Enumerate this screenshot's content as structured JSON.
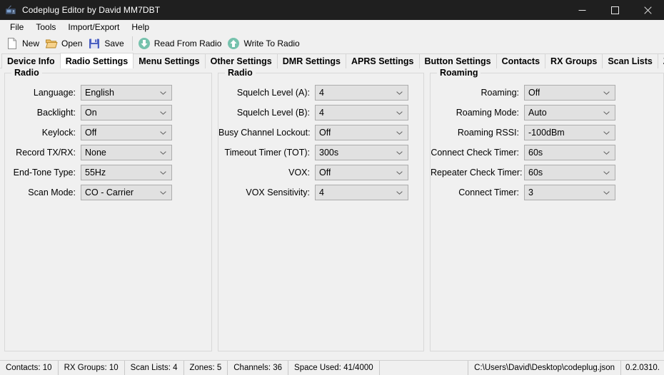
{
  "window": {
    "title": "Codeplug Editor by David MM7DBT",
    "icon": "radio-app-icon",
    "controls": {
      "minimize": "minimize-icon",
      "maximize": "maximize-icon",
      "close": "close-icon"
    },
    "titlebar_bg": "#1f1f1f",
    "titlebar_fg": "#ffffff"
  },
  "menubar": {
    "items": [
      {
        "label": "File"
      },
      {
        "label": "Tools"
      },
      {
        "label": "Import/Export"
      },
      {
        "label": "Help"
      }
    ]
  },
  "toolbar": {
    "buttons": [
      {
        "label": "New",
        "icon": "new-file-icon"
      },
      {
        "label": "Open",
        "icon": "open-folder-icon"
      },
      {
        "label": "Save",
        "icon": "save-floppy-icon"
      },
      {
        "label": "Read From Radio",
        "icon": "download-arrow-icon"
      },
      {
        "label": "Write To Radio",
        "icon": "upload-arrow-icon"
      }
    ],
    "accent_green": "#76c2ad",
    "folder_color": "#e8a22e",
    "floppy_color": "#4a5fc1"
  },
  "tabs": {
    "active": "Radio Settings",
    "items": [
      {
        "label": "Device Info"
      },
      {
        "label": "Radio Settings"
      },
      {
        "label": "Menu Settings"
      },
      {
        "label": "Other Settings"
      },
      {
        "label": "DMR Settings"
      },
      {
        "label": "APRS Settings"
      },
      {
        "label": "Button Settings"
      },
      {
        "label": "Contacts"
      },
      {
        "label": "RX Groups"
      },
      {
        "label": "Scan Lists"
      },
      {
        "label": "Zones/Channels"
      }
    ]
  },
  "panels": [
    {
      "title": "Radio",
      "fields": [
        {
          "label": "Language:",
          "value": "English"
        },
        {
          "label": "Backlight:",
          "value": "On"
        },
        {
          "label": "Keylock:",
          "value": "Off"
        },
        {
          "label": "Record TX/RX:",
          "value": "None"
        },
        {
          "label": "End-Tone Type:",
          "value": "55Hz"
        },
        {
          "label": "Scan Mode:",
          "value": "CO - Carrier"
        }
      ]
    },
    {
      "title": "Radio",
      "fields": [
        {
          "label": "Squelch Level (A):",
          "value": "4"
        },
        {
          "label": "Squelch Level (B):",
          "value": "4"
        },
        {
          "label": "Busy Channel Lockout:",
          "value": "Off"
        },
        {
          "label": "Timeout Timer (TOT):",
          "value": "300s"
        },
        {
          "label": "VOX:",
          "value": "Off"
        },
        {
          "label": "VOX Sensitivity:",
          "value": "4"
        }
      ]
    },
    {
      "title": "Roaming",
      "fields": [
        {
          "label": "Roaming:",
          "value": "Off"
        },
        {
          "label": "Roaming Mode:",
          "value": "Auto"
        },
        {
          "label": "Roaming RSSI:",
          "value": "-100dBm"
        },
        {
          "label": "Connect Check Timer:",
          "value": "60s"
        },
        {
          "label": "Repeater Check Timer:",
          "value": "60s"
        },
        {
          "label": "Connect Timer:",
          "value": "3"
        }
      ]
    }
  ],
  "statusbar": {
    "cells": [
      {
        "label": "Contacts: 10"
      },
      {
        "label": "RX Groups: 10"
      },
      {
        "label": "Scan Lists: 4"
      },
      {
        "label": "Zones: 5"
      },
      {
        "label": "Channels: 36"
      },
      {
        "label": "Space Used: 41/4000"
      }
    ],
    "file_path": "C:\\Users\\David\\Desktop\\codeplug.json",
    "version": "0.2.0310."
  }
}
